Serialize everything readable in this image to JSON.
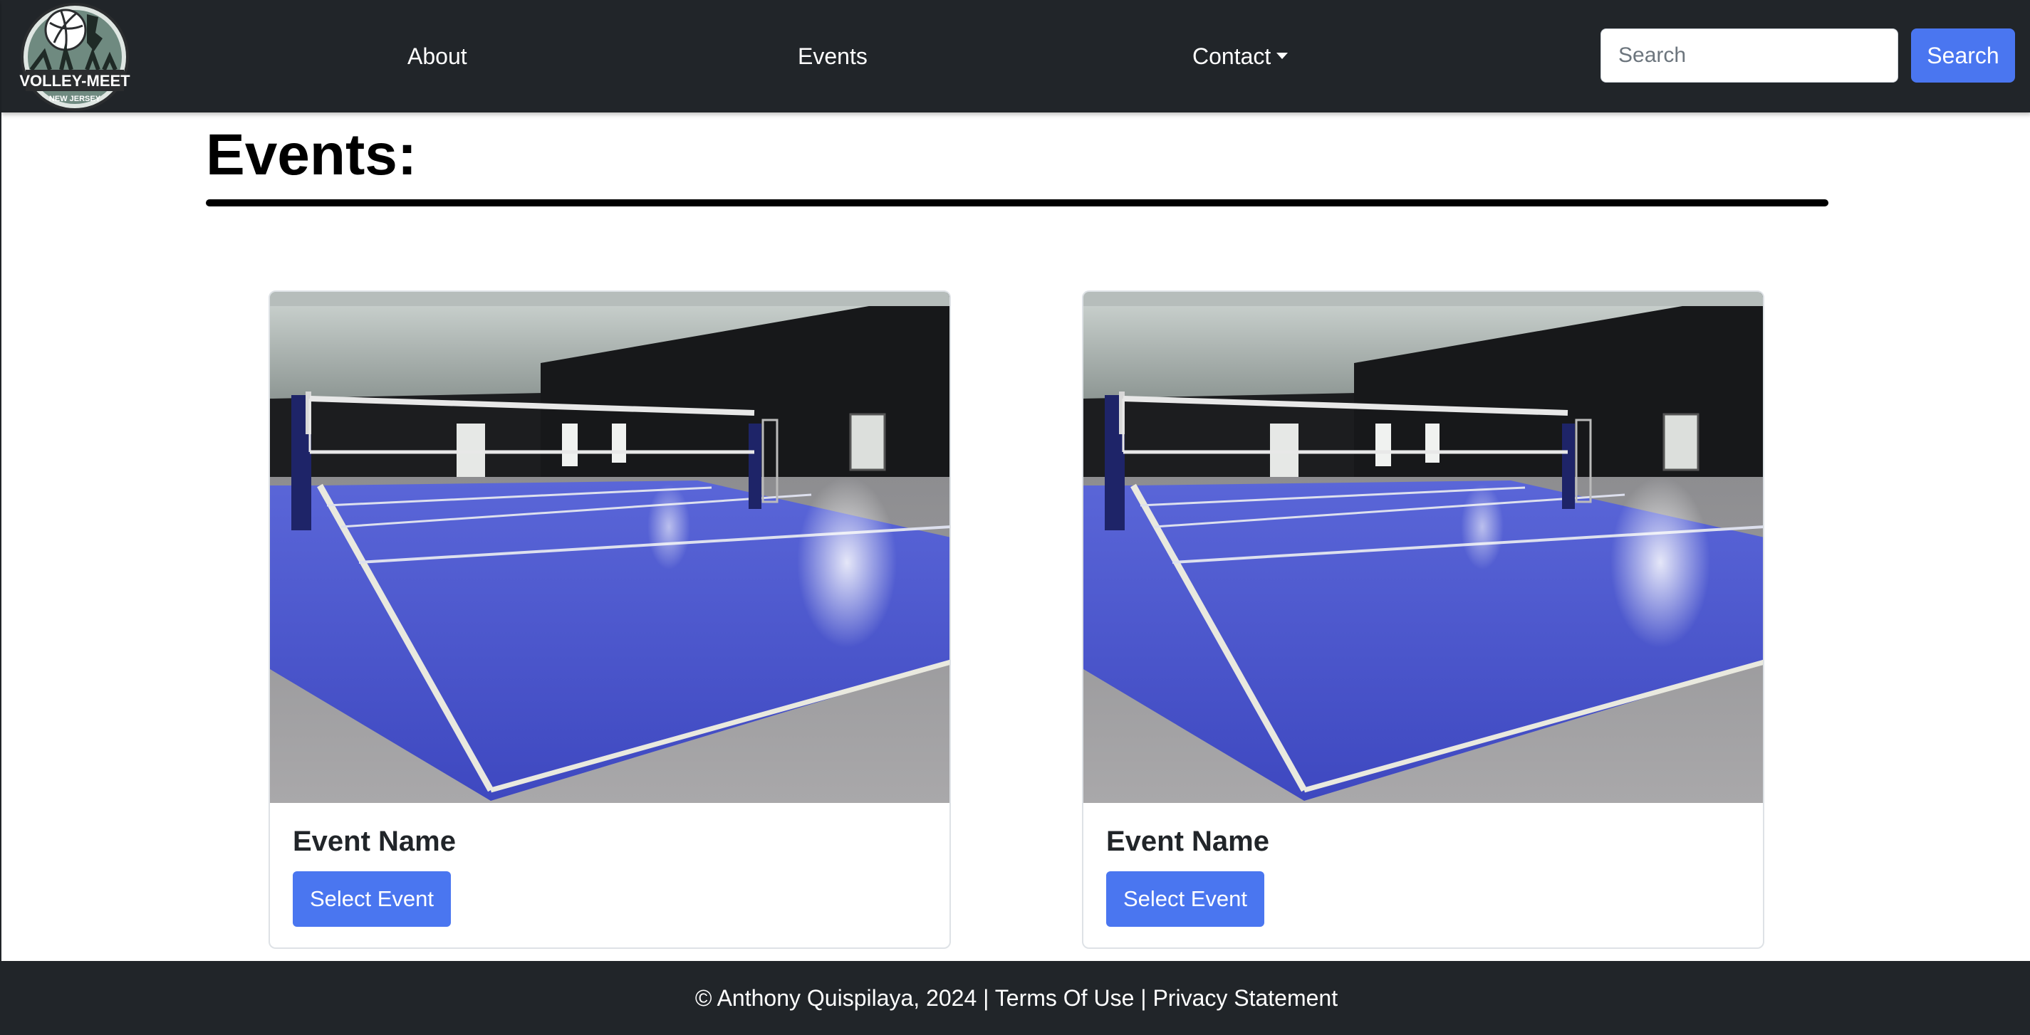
{
  "navbar": {
    "logo_text": "VOLLEY-MEET",
    "logo_subtext": "NEW JERSEY",
    "links": {
      "about": "About",
      "events": "Events",
      "contact": "Contact"
    },
    "search": {
      "placeholder": "Search",
      "value": "",
      "button_label": "Search"
    },
    "colors": {
      "background": "#212529",
      "accent": "#4a76f0"
    }
  },
  "main": {
    "title": "Events:",
    "cards": [
      {
        "image": "volleyball-court-photo",
        "name": "Event Name",
        "button_label": "Select Event"
      },
      {
        "image": "volleyball-court-photo",
        "name": "Event Name",
        "button_label": "Select Event"
      }
    ]
  },
  "footer": {
    "copyright": "© Anthony Quispilaya, 2024",
    "separator": "|",
    "terms_label": "Terms Of Use",
    "privacy_label": "Privacy Statement"
  }
}
